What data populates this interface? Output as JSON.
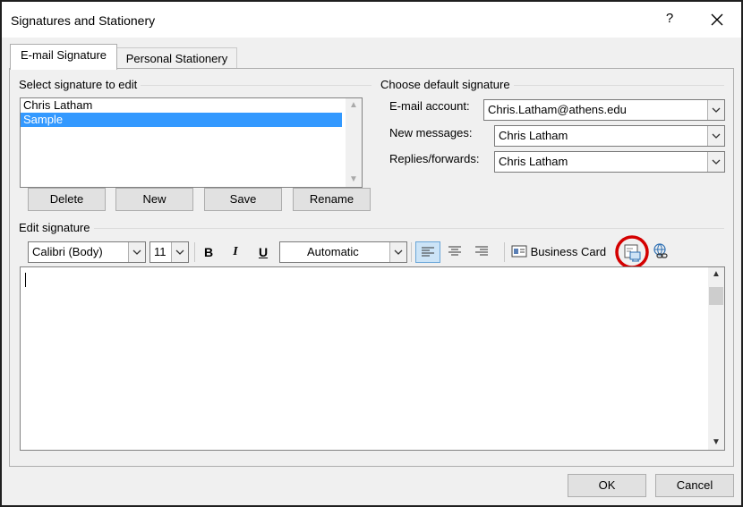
{
  "window": {
    "title": "Signatures and Stationery",
    "help_label": "?"
  },
  "tabs": [
    {
      "label": "E-mail Signature"
    },
    {
      "label": "Personal Stationery"
    }
  ],
  "select_group": {
    "label": "Select signature to edit",
    "items": [
      "Chris Latham",
      "Sample"
    ],
    "selected": "Sample"
  },
  "signature_buttons": {
    "delete": "Delete",
    "new": "New",
    "save": "Save",
    "rename": "Rename"
  },
  "default_group": {
    "label": "Choose default signature",
    "email_account_label": "E-mail account:",
    "email_account_value": "Chris.Latham@athens.edu",
    "new_messages_label": "New messages:",
    "new_messages_value": "Chris Latham",
    "replies_label": "Replies/forwards:",
    "replies_value": "Chris Latham"
  },
  "edit_group": {
    "label": "Edit signature",
    "font_value": "Calibri (Body)",
    "size_value": "11",
    "bold_label": "B",
    "italic_label": "I",
    "underline_label": "U",
    "color_value": "Automatic",
    "business_card_label": "Business Card",
    "highlight_color": "#d40000"
  },
  "footer": {
    "ok": "OK",
    "cancel": "Cancel"
  },
  "colors": {
    "selection": "#3399ff",
    "dialog_bg": "#f0f0f0"
  }
}
